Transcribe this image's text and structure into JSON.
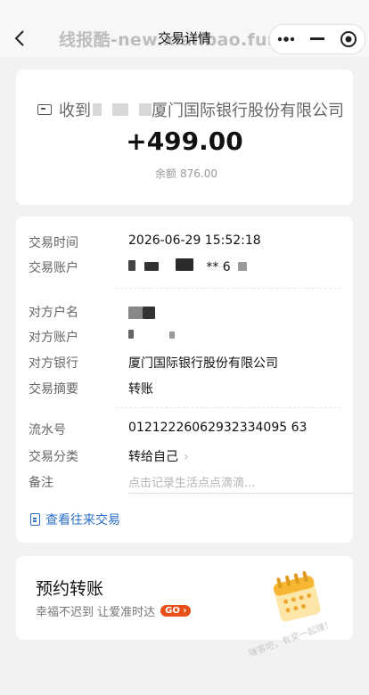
{
  "header": {
    "title": "交易详情",
    "watermark": "线报酷-new.xianbao.fun",
    "menu_icon": "more-dots-icon",
    "minimize_icon": "minimize-icon",
    "close_icon": "target-close-icon"
  },
  "summary": {
    "counterparty_prefix": "收到",
    "counterparty_bank": "厦门国际银行股份有限公司",
    "amount": "+499.00",
    "balance_label": "余额",
    "balance_value": "876.00"
  },
  "details": {
    "time_label": "交易时间",
    "time_value": "2026-06-29 15:52:18",
    "account_label": "交易账户",
    "account_value": "** 6",
    "opp_name_label": "对方户名",
    "opp_account_label": "对方账户",
    "opp_bank_label": "对方银行",
    "opp_bank_value": "厦门国际银行股份有限公司",
    "summary_label": "交易摘要",
    "summary_value": "转账",
    "serial_label": "流水号",
    "serial_value": "01212226062932334095 63",
    "category_label": "交易分类",
    "category_value": "转给自己",
    "note_label": "备注",
    "note_placeholder": "点击记录生活点点滴滴...",
    "history_link": "查看往来交易"
  },
  "schedule": {
    "title": "预约转账",
    "subtitle": "幸福不迟到 让爱准时达",
    "go_label": "GO ›"
  },
  "corner_watermark": "赚客吧，有奖一起赚！"
}
